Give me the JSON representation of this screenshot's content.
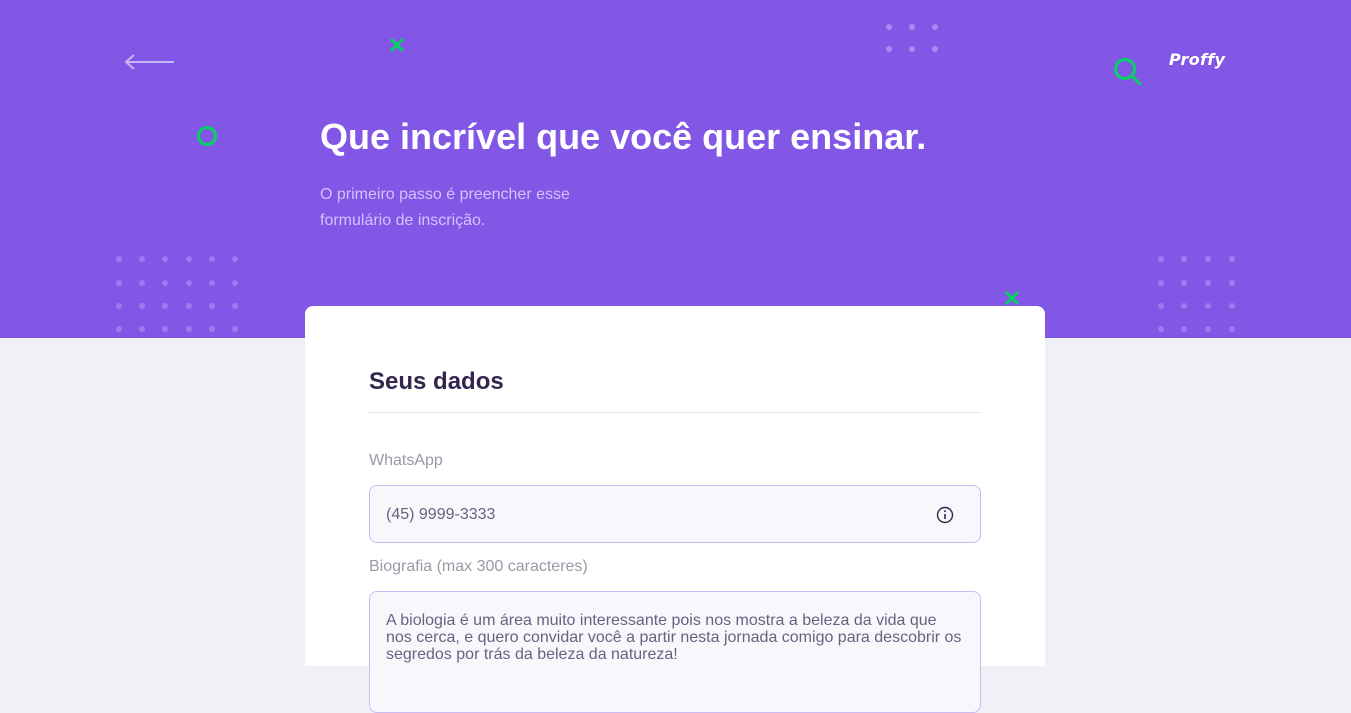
{
  "header": {
    "brand": "Proffy",
    "back_label": "back-arrow-icon",
    "title": "Que incrível que você quer ensinar.",
    "subtitle": "O primeiro passo é preencher esse formulário de inscrição."
  },
  "form": {
    "section_title": "Seus dados",
    "whatsapp": {
      "label": "WhatsApp",
      "value": "(45) 9999-3333",
      "icon": "info-icon"
    },
    "bio": {
      "label": "Biografia (max 300 caracteres)",
      "value": "A biologia é um área muito interessante pois nos mostra a beleza da vida que nos cerca, e quero convidar você a partir nesta jornada comigo para descobrir os segredos por trás da beleza da natureza!"
    }
  },
  "colors": {
    "primary": "#8257e5",
    "accent": "#04d361",
    "background": "#f0f0f7",
    "title_text": "#32264d"
  }
}
